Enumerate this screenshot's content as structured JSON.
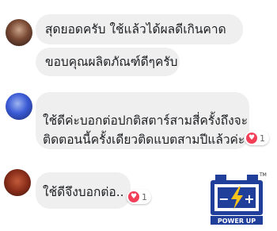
{
  "comments": [
    {
      "text": "สุดยอดครับ ใช้แล้วได้ผลดีเกินคาด"
    },
    {
      "text": "ขอบคุณผลิตภัณฑ์ดีๆครับ"
    },
    {
      "lines": [
        "ใช้ดีค่ะบอกต่อปกติสตาร์สามสี่ครั้งถึงจะ",
        "ติดตอนนี้ครั้งเดียวติดแบตสามปีแล้วค่ะ"
      ],
      "reaction_count": "1"
    },
    {
      "text": "ใช้ดีจึงบอกต่อ..",
      "reaction_count": "1"
    }
  ],
  "logo": {
    "text": "POWER UP",
    "trademark": "TM",
    "minus": "−",
    "plus": "+"
  },
  "colors": {
    "bubble": "#efefef",
    "heart": "#f33e58",
    "logo_blue": "#1f3f9b",
    "logo_bolt": "#f6c21c"
  }
}
